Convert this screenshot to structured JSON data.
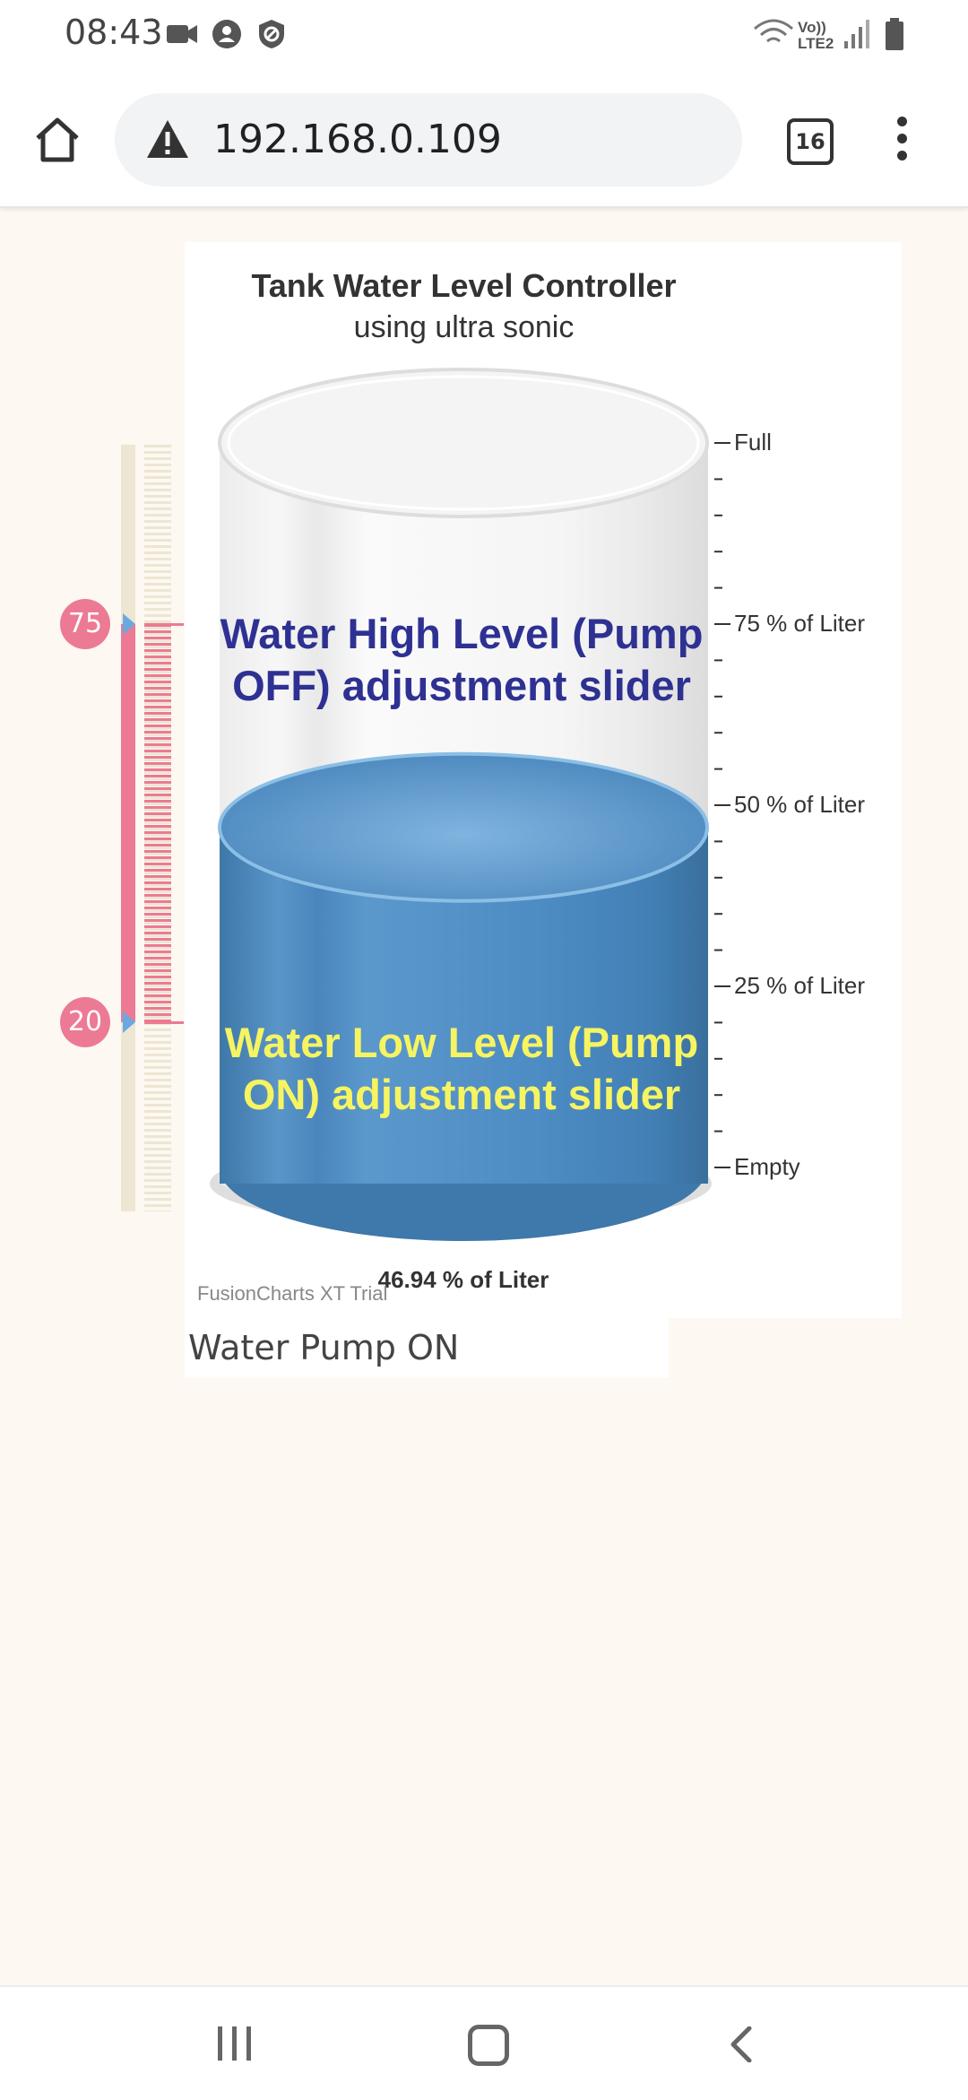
{
  "status_bar": {
    "time": "08:43",
    "network_label": "Vo)) LTE2"
  },
  "browser": {
    "url": "192.168.0.109",
    "tab_count": "16"
  },
  "chart": {
    "title": "Tank Water Level Controller",
    "subtitle": "using ultra sonic",
    "watermark": "FusionCharts XT Trial",
    "value_label": "46.94 % of Liter",
    "annotation_high": "Water High Level (Pump OFF) adjustment slider",
    "annotation_low": "Water Low Level (Pump ON) adjustment slider",
    "colors": {
      "water": "#4d8fc7",
      "slider": "#ec7a95",
      "annotation_high": "#2e3192",
      "annotation_low": "#f6f461"
    }
  },
  "chart_data": {
    "type": "cylinder-gauge",
    "value": 46.94,
    "unit": "% of Liter",
    "range": [
      0,
      100
    ],
    "major_ticks": [
      {
        "value": 100,
        "label": "Full"
      },
      {
        "value": 75,
        "label": "75 % of Liter"
      },
      {
        "value": 50,
        "label": "50 % of Liter"
      },
      {
        "value": 25,
        "label": "25 % of Liter"
      },
      {
        "value": 0,
        "label": "Empty"
      }
    ],
    "minor_ticks_between_major": 4
  },
  "slider": {
    "high": 75,
    "low": 20,
    "range": [
      0,
      100
    ]
  },
  "pump_status": "Water Pump ON"
}
